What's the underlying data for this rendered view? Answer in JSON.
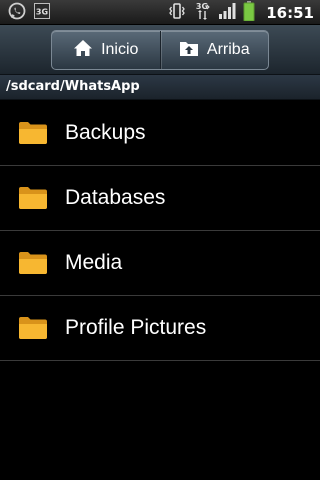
{
  "status_bar": {
    "time": "16:51",
    "icons": [
      "whatsapp-icon",
      "3g-icon",
      "vibrate-icon",
      "3g-data-icon",
      "signal-icon",
      "battery-icon"
    ]
  },
  "toolbar": {
    "home_label": "Inicio",
    "up_label": "Arriba"
  },
  "path": "/sdcard/WhatsApp",
  "files": [
    {
      "name": "Backups",
      "icon": "folder-icon"
    },
    {
      "name": "Databases",
      "icon": "folder-icon"
    },
    {
      "name": "Media",
      "icon": "folder-icon"
    },
    {
      "name": "Profile Pictures",
      "icon": "folder-icon"
    }
  ],
  "colors": {
    "folder": "#f7b731",
    "folder_dark": "#d9931a",
    "battery": "#7ac943",
    "divider": "#3a3a3a"
  }
}
